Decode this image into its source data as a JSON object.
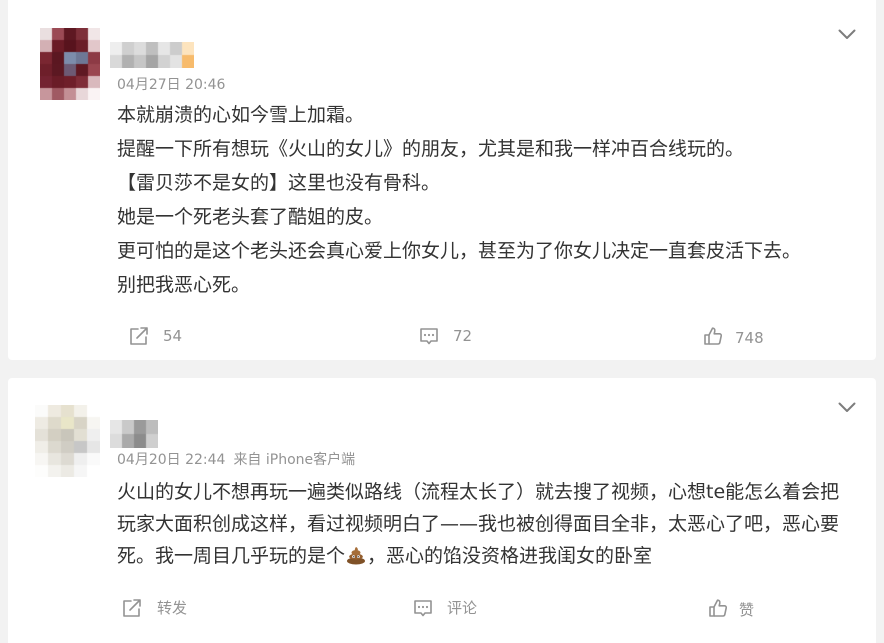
{
  "colors": {
    "page_background": "#f2f2f2",
    "card_background": "#ffffff",
    "body_text": "#333333",
    "meta_text": "#939393"
  },
  "icons": {
    "menu": "chevron-down-icon",
    "repost": "repost-icon",
    "comment": "comment-icon",
    "like": "like-icon",
    "emoji": "pile-of-poo-emoji-icon"
  },
  "posts": [
    {
      "timestamp": "04月27日 20:46",
      "lines": [
        "本就崩溃的心如今雪上加霜。",
        "提醒一下所有想玩《火山的女儿》的朋友，尤其是和我一样冲百合线玩的。",
        "【雷贝莎不是女的】这里也没有骨科。",
        "她是一个死老头套了酷姐的皮。",
        "更可怕的是这个老头还会真心爱上你女儿，甚至为了你女儿决定一直套皮活下去。",
        "别把我恶心死。"
      ],
      "actions": {
        "repost": "54",
        "comment": "72",
        "like": "748"
      }
    },
    {
      "timestamp": "04月20日 22:44",
      "source": "来自 iPhone客户端",
      "lines": [
        "火山的女儿不想再玩一遍类似路线（流程太长了）就去搜了视频，心想te能怎么着会把",
        "玩家大面积创成这样，看过视频明白了——我也被创得面目全非，太恶心了吧，恶心要"
      ],
      "last_line": {
        "before": "死。我一周目几乎玩的是个",
        "after": "，恶心的馅没资格进我闺女的卧室"
      },
      "actions": {
        "repost": "转发",
        "comment": "评论",
        "like": "赞"
      }
    }
  ]
}
